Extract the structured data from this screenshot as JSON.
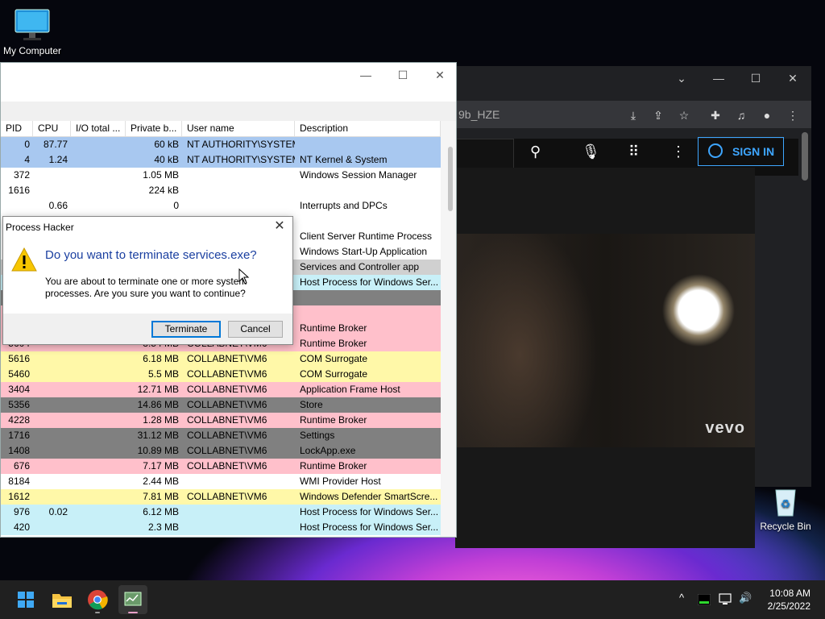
{
  "desktop": {
    "my_computer": "My Computer",
    "recycle_bin": "Recycle Bin"
  },
  "browser": {
    "url": "9b_HZE",
    "sign_in": "SIGN IN",
    "vevo": "vevo"
  },
  "process_hacker": {
    "columns": [
      "PID",
      "CPU",
      "I/O total ...",
      "Private b...",
      "User name",
      "Description"
    ],
    "rows": [
      {
        "pid": "0",
        "cpu": "87.77",
        "io": "",
        "priv": "60 kB",
        "user": "NT AUTHORITY\\SYSTEM",
        "desc": "",
        "color": "#a8c8f0"
      },
      {
        "pid": "4",
        "cpu": "1.24",
        "io": "",
        "priv": "40 kB",
        "user": "NT AUTHORITY\\SYSTEM",
        "desc": "NT Kernel & System",
        "color": "#a8c8f0"
      },
      {
        "pid": "372",
        "cpu": "",
        "io": "",
        "priv": "1.05 MB",
        "user": "",
        "desc": "Windows Session Manager",
        "color": "#ffffff"
      },
      {
        "pid": "1616",
        "cpu": "",
        "io": "",
        "priv": "224 kB",
        "user": "",
        "desc": "",
        "color": "#ffffff"
      },
      {
        "pid": "",
        "cpu": "0.66",
        "io": "",
        "priv": "0",
        "user": "",
        "desc": "Interrupts and DPCs",
        "color": "#ffffff"
      },
      {
        "pid": "",
        "cpu": "",
        "io": "",
        "priv": "",
        "user": "",
        "desc": "",
        "color": "#ffffff"
      },
      {
        "pid": "",
        "cpu": "",
        "io": "",
        "priv": "",
        "user": "",
        "desc": "Client Server Runtime Process",
        "color": "#ffffff"
      },
      {
        "pid": "",
        "cpu": "",
        "io": "",
        "priv": "",
        "user": "",
        "desc": "Windows Start-Up Application",
        "color": "#ffffff"
      },
      {
        "pid": "",
        "cpu": "",
        "io": "",
        "priv": "",
        "user": "",
        "desc": "Services and Controller app",
        "color": "#d0d0d0"
      },
      {
        "pid": "",
        "cpu": "",
        "io": "",
        "priv": "",
        "user": "",
        "desc": "Host Process for Windows Ser...",
        "color": "#c8f0f8"
      },
      {
        "pid": "",
        "cpu": "",
        "io": "",
        "priv": "",
        "user": "",
        "desc": "",
        "color": "#808080"
      },
      {
        "pid": "",
        "cpu": "",
        "io": "",
        "priv": "",
        "user": "",
        "desc": "",
        "color": "#ffc0cb"
      },
      {
        "pid": "",
        "cpu": "",
        "io": "",
        "priv": "",
        "user": "",
        "desc": "Runtime Broker",
        "color": "#ffc0cb"
      },
      {
        "pid": "5604",
        "cpu": "",
        "io": "",
        "priv": "3.54 MB",
        "user": "COLLABNET\\VM6",
        "desc": "Runtime Broker",
        "color": "#ffc0cb"
      },
      {
        "pid": "5616",
        "cpu": "",
        "io": "",
        "priv": "6.18 MB",
        "user": "COLLABNET\\VM6",
        "desc": "COM Surrogate",
        "color": "#fff8a8"
      },
      {
        "pid": "5460",
        "cpu": "",
        "io": "",
        "priv": "5.5 MB",
        "user": "COLLABNET\\VM6",
        "desc": "COM Surrogate",
        "color": "#fff8a8"
      },
      {
        "pid": "3404",
        "cpu": "",
        "io": "",
        "priv": "12.71 MB",
        "user": "COLLABNET\\VM6",
        "desc": "Application Frame Host",
        "color": "#ffc0cb"
      },
      {
        "pid": "5356",
        "cpu": "",
        "io": "",
        "priv": "14.86 MB",
        "user": "COLLABNET\\VM6",
        "desc": "Store",
        "color": "#808080"
      },
      {
        "pid": "4228",
        "cpu": "",
        "io": "",
        "priv": "1.28 MB",
        "user": "COLLABNET\\VM6",
        "desc": "Runtime Broker",
        "color": "#ffc0cb"
      },
      {
        "pid": "1716",
        "cpu": "",
        "io": "",
        "priv": "31.12 MB",
        "user": "COLLABNET\\VM6",
        "desc": "Settings",
        "color": "#808080"
      },
      {
        "pid": "1408",
        "cpu": "",
        "io": "",
        "priv": "10.89 MB",
        "user": "COLLABNET\\VM6",
        "desc": "LockApp.exe",
        "color": "#808080"
      },
      {
        "pid": "676",
        "cpu": "",
        "io": "",
        "priv": "7.17 MB",
        "user": "COLLABNET\\VM6",
        "desc": "Runtime Broker",
        "color": "#ffc0cb"
      },
      {
        "pid": "8184",
        "cpu": "",
        "io": "",
        "priv": "2.44 MB",
        "user": "",
        "desc": "WMI Provider Host",
        "color": "#ffffff"
      },
      {
        "pid": "1612",
        "cpu": "",
        "io": "",
        "priv": "7.81 MB",
        "user": "COLLABNET\\VM6",
        "desc": "Windows Defender SmartScre...",
        "color": "#fff8a8"
      },
      {
        "pid": "976",
        "cpu": "0.02",
        "io": "",
        "priv": "6.12 MB",
        "user": "",
        "desc": "Host Process for Windows Ser...",
        "color": "#c8f0f8"
      },
      {
        "pid": "420",
        "cpu": "",
        "io": "",
        "priv": "2.3 MB",
        "user": "",
        "desc": "Host Process for Windows Ser...",
        "color": "#c8f0f8"
      }
    ]
  },
  "dialog": {
    "title": "Process Hacker",
    "heading": "Do you want to terminate services.exe?",
    "message": "You are about to terminate one or more system processes. Are you sure you want to continue?",
    "terminate": "Terminate",
    "cancel": "Cancel"
  },
  "taskbar": {
    "time": "10:08 AM",
    "date": "2/25/2022"
  }
}
